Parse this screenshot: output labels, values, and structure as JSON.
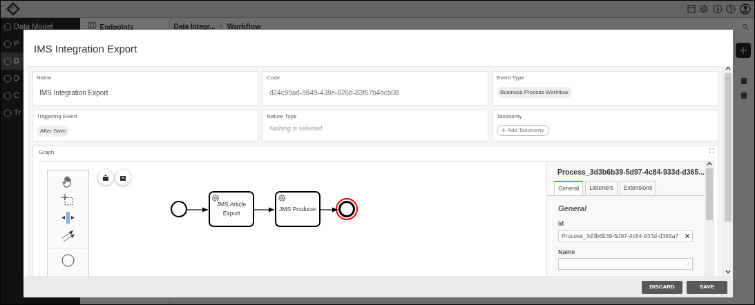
{
  "app": {
    "sidebar": [
      {
        "label": "Data Model",
        "selected": false
      },
      {
        "label": "P",
        "selected": false
      },
      {
        "label": "D",
        "selected": true
      },
      {
        "label": "D",
        "selected": false
      },
      {
        "label": "C",
        "selected": false
      },
      {
        "label": "Tr",
        "selected": false
      }
    ],
    "panel_title": "Endpoints",
    "breadcrumb": [
      "Data Integr...",
      "Workflow"
    ]
  },
  "modal": {
    "title": "IMS Integration Export",
    "fields": [
      {
        "kind": "text",
        "label": "Name",
        "value": "IMS Integration Export"
      },
      {
        "kind": "readonly",
        "label": "Code",
        "value": "d24c99ad-9849-438e-826b-83f67b4bcb08"
      },
      {
        "kind": "chips",
        "label": "Event Type",
        "chips": [
          "Business Process Workflow"
        ]
      },
      {
        "kind": "chips",
        "label": "Triggering Event",
        "chips": [
          "After Save"
        ]
      },
      {
        "kind": "select",
        "label": "Nature Type",
        "placeholder": "Nothing is selected"
      },
      {
        "kind": "add",
        "label": "Taxonomy",
        "button": "Add Taxonomy"
      }
    ],
    "graph": {
      "label": "Graph",
      "nodes": [
        {
          "kind": "start",
          "selected": false
        },
        {
          "kind": "task",
          "label": "JMS Article Export",
          "selected": false
        },
        {
          "kind": "task",
          "label": "JMS Producer",
          "selected": false
        },
        {
          "kind": "end",
          "selected": true
        }
      ],
      "properties": {
        "title": "Process_3d3b6b39-5d97-4c84-933d-d365...",
        "tabs": [
          {
            "label": "General",
            "selected": true
          },
          {
            "label": "Listeners",
            "selected": false
          },
          {
            "label": "Extensions",
            "selected": false
          }
        ],
        "section": "General",
        "fields": [
          {
            "label": "Id",
            "value": "Process_3d3b6b39-5d97-4c84-933d-d365a7"
          },
          {
            "label": "Name"
          }
        ]
      }
    },
    "buttons": [
      "DISCARD",
      "SAVE"
    ]
  }
}
